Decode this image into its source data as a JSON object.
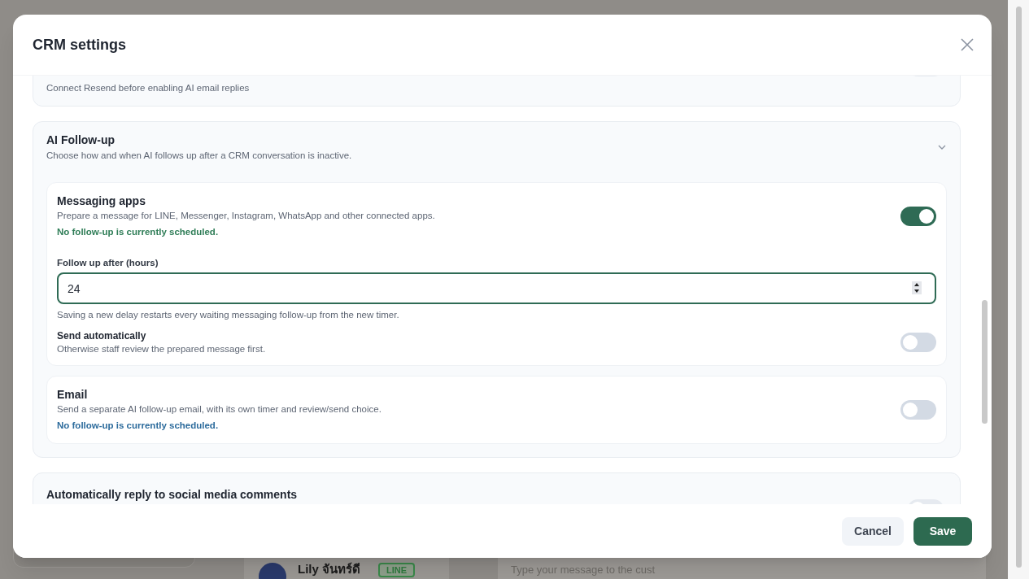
{
  "background": {
    "contact": {
      "name": "Lily จันทร์ดี",
      "channel": "LINE"
    },
    "composer": {
      "placeholder": "Type your message to the cust"
    }
  },
  "dialog": {
    "title": "CRM settings",
    "sections": [
      {
        "kind": "cut_top",
        "description": "Connect Resend before enabling AI email replies",
        "toggle": {
          "on": false
        }
      },
      {
        "kind": "accordion",
        "title": "AI Follow-up",
        "description": "Choose how and when AI follows up after a CRM conversation is inactive.",
        "expanded": true,
        "channels": [
          {
            "title": "Messaging apps",
            "description": "Prepare a message for LINE, Messenger, Instagram, WhatsApp and other connected apps.",
            "status": {
              "text": "No follow-up is currently scheduled.",
              "color": "#2f7d57"
            },
            "on": true,
            "delay": {
              "label": "Follow up after (hours)",
              "value": "24",
              "hint": "Saving a new delay restarts every waiting messaging follow-up from the new timer."
            },
            "auto_send": {
              "label": "Send automatically",
              "description": "Otherwise staff review the prepared message first.",
              "on": false
            }
          },
          {
            "title": "Email",
            "description": "Send a separate AI follow-up email, with its own timer and review/send choice.",
            "status": {
              "text": "No follow-up is currently scheduled.",
              "color": "#2c6b9c"
            },
            "on": false
          }
        ]
      },
      {
        "kind": "cut_bottom",
        "title": "Automatically reply to social media comments",
        "toggle": {
          "on": false
        }
      }
    ],
    "buttons": [
      {
        "label": "Cancel",
        "kind": "secondary"
      },
      {
        "label": "Save",
        "kind": "primary"
      }
    ]
  }
}
